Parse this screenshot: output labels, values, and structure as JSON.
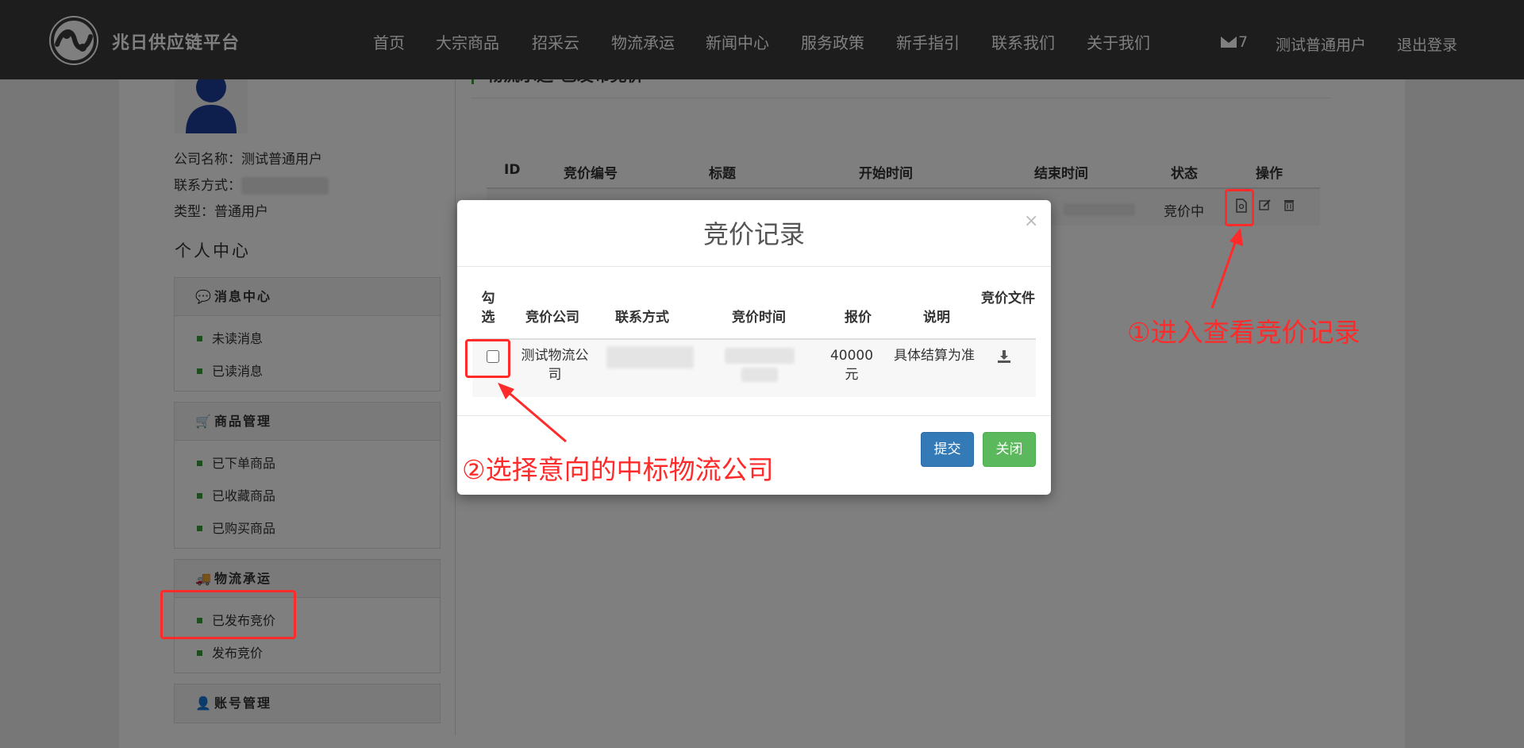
{
  "brand": {
    "name": "兆日供应链平台"
  },
  "nav": {
    "items": [
      "首页",
      "大宗商品",
      "招采云",
      "物流承运",
      "新闻中心",
      "服务政策",
      "新手指引",
      "联系我们",
      "关于我们"
    ],
    "mail_count": "7",
    "user_name": "测试普通用户",
    "logout_label": "退出登录"
  },
  "profile": {
    "company_label": "公司名称：",
    "company_value": "测试普通用户",
    "contact_label": "联系方式：",
    "type_label": "类型：",
    "type_value": "普通用户"
  },
  "sidebar": {
    "title": "个人中心",
    "sections": [
      {
        "title": "消息中心",
        "icon": "comment-icon",
        "items": [
          "未读消息",
          "已读消息"
        ]
      },
      {
        "title": "商品管理",
        "icon": "cart-icon",
        "items": [
          "已下单商品",
          "已收藏商品",
          "已购买商品"
        ]
      },
      {
        "title": "物流承运",
        "icon": "truck-icon",
        "items": [
          "已发布竞价",
          "发布竞价"
        ]
      },
      {
        "title": "账号管理",
        "icon": "user-icon",
        "items": []
      }
    ]
  },
  "page": {
    "heading": "物流承运-已发布竞价",
    "columns": [
      "ID",
      "竞价编号",
      "标题",
      "开始时间",
      "结束时间",
      "状态",
      "操作"
    ],
    "row": {
      "status": "竞价中"
    },
    "actions": [
      "view-record-icon",
      "edit-icon",
      "trash-icon"
    ]
  },
  "modal": {
    "title": "竞价记录",
    "close": "×",
    "columns": [
      "勾选",
      "竞价公司",
      "联系方式",
      "竞价时间",
      "报价",
      "说明",
      "竞价文件"
    ],
    "row": {
      "company": "测试物流公司",
      "price": "40000元",
      "note": "具体结算为准"
    },
    "submit_label": "提交",
    "close_label": "关闭"
  },
  "annotations": {
    "step1": "①进入查看竞价记录",
    "step2": "②选择意向的中标物流公司",
    "color": "#ff2a2a"
  }
}
